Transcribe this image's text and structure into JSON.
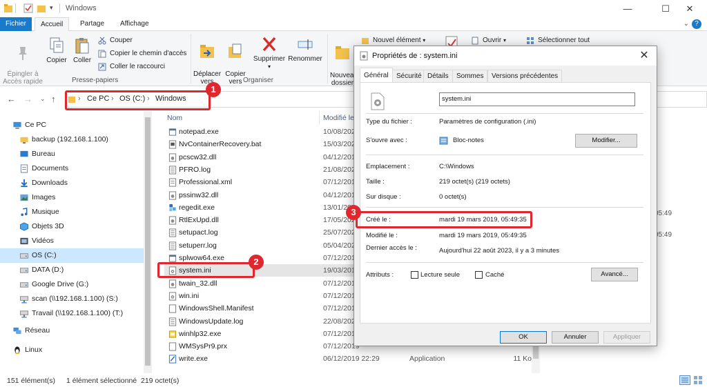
{
  "window": {
    "title": "Windows"
  },
  "ribbon_tabs": [
    "Fichier",
    "Accueil",
    "Partage",
    "Affichage"
  ],
  "ribbon": {
    "pin_label": "Épingler à\nAccès rapide",
    "copy_label": "Copier",
    "paste_label": "Coller",
    "cut_label": "Couper",
    "copy_path_label": "Copier le chemin d'accès",
    "paste_shortcut_label": "Coller le raccourci",
    "clipboard_group": "Presse-papiers",
    "move_label": "Déplacer\nvers",
    "copy_to_label": "Copier\nvers",
    "delete_label": "Supprimer",
    "rename_label": "Renommer",
    "organize_group": "Organiser",
    "new_folder_label": "Nouveau\ndossier",
    "new_item_label": "Nouvel élément",
    "open_label": "Ouvrir",
    "select_all_label": "Sélectionner tout"
  },
  "address": {
    "crumbs": [
      "Ce PC",
      "OS (C:)",
      "Windows"
    ]
  },
  "nav": [
    {
      "label": "Ce PC",
      "icon": "pc-icon",
      "indent": 0
    },
    {
      "label": "backup (192.168.1.100)",
      "icon": "network-folder-icon",
      "indent": 1
    },
    {
      "label": "Bureau",
      "icon": "desktop-icon",
      "indent": 1
    },
    {
      "label": "Documents",
      "icon": "documents-icon",
      "indent": 1
    },
    {
      "label": "Downloads",
      "icon": "downloads-icon",
      "indent": 1
    },
    {
      "label": "Images",
      "icon": "images-icon",
      "indent": 1
    },
    {
      "label": "Musique",
      "icon": "music-icon",
      "indent": 1
    },
    {
      "label": "Objets 3D",
      "icon": "3d-objects-icon",
      "indent": 1
    },
    {
      "label": "Vidéos",
      "icon": "videos-icon",
      "indent": 1
    },
    {
      "label": "OS (C:)",
      "icon": "drive-icon",
      "indent": 1,
      "selected": true
    },
    {
      "label": "DATA (D:)",
      "icon": "drive-icon",
      "indent": 1
    },
    {
      "label": "Google Drive (G:)",
      "icon": "drive-icon",
      "indent": 1
    },
    {
      "label": "scan (\\\\192.168.1.100) (S:)",
      "icon": "network-drive-icon",
      "indent": 1
    },
    {
      "label": "Travail (\\\\192.168.1.100) (T:)",
      "icon": "network-drive-icon",
      "indent": 1
    },
    {
      "label": "Réseau",
      "icon": "network-icon",
      "indent": 0
    },
    {
      "label": "Linux",
      "icon": "linux-icon",
      "indent": 0
    }
  ],
  "file_list": {
    "columns": [
      "Nom",
      "Modifié le"
    ],
    "rows": [
      {
        "name": "notepad.exe",
        "date": "10/08/2022",
        "type": "",
        "size": "",
        "icon": "exe-icon"
      },
      {
        "name": "NvContainerRecovery.bat",
        "date": "15/03/2022",
        "type": "",
        "size": "",
        "icon": "bat-icon"
      },
      {
        "name": "pcscw32.dll",
        "date": "04/12/2019",
        "type": "",
        "size": "",
        "icon": "dll-icon"
      },
      {
        "name": "PFRO.log",
        "date": "21/08/2023",
        "type": "",
        "size": "",
        "icon": "log-icon"
      },
      {
        "name": "Professional.xml",
        "date": "07/12/2019",
        "type": "",
        "size": "",
        "icon": "xml-icon"
      },
      {
        "name": "pssinw32.dll",
        "date": "04/12/2019",
        "type": "",
        "size": "",
        "icon": "dll-icon"
      },
      {
        "name": "regedit.exe",
        "date": "13/01/2023",
        "type": "",
        "size": "",
        "icon": "regedit-icon"
      },
      {
        "name": "RtlExUpd.dll",
        "date": "17/05/2022",
        "type": "",
        "size": "",
        "icon": "dll-icon"
      },
      {
        "name": "setupact.log",
        "date": "25/07/2023",
        "type": "",
        "size": "",
        "icon": "log-icon"
      },
      {
        "name": "setuperr.log",
        "date": "05/04/2023",
        "type": "",
        "size": "",
        "icon": "log-icon"
      },
      {
        "name": "splwow64.exe",
        "date": "07/12/2019",
        "type": "",
        "size": "",
        "icon": "exe-icon"
      },
      {
        "name": "system.ini",
        "date": "19/03/2019",
        "type": "",
        "size": "",
        "icon": "ini-icon",
        "selected": true
      },
      {
        "name": "twain_32.dll",
        "date": "07/12/2019",
        "type": "",
        "size": "",
        "icon": "dll-icon"
      },
      {
        "name": "win.ini",
        "date": "07/12/2019",
        "type": "",
        "size": "",
        "icon": "ini-icon"
      },
      {
        "name": "WindowsShell.Manifest",
        "date": "07/12/2019",
        "type": "",
        "size": "",
        "icon": "manifest-icon"
      },
      {
        "name": "WindowsUpdate.log",
        "date": "22/08/2023",
        "type": "",
        "size": "",
        "icon": "log-icon"
      },
      {
        "name": "winhlp32.exe",
        "date": "07/12/2019",
        "type": "",
        "size": "",
        "icon": "help-exe-icon"
      },
      {
        "name": "WMSysPr9.prx",
        "date": "07/12/2019",
        "type": "",
        "size": "",
        "icon": "file-icon"
      },
      {
        "name": "write.exe",
        "date": "06/12/2019 22:29",
        "type": "Application",
        "size": "11 Ko",
        "icon": "write-icon"
      }
    ],
    "bg_times": [
      "05:49",
      "05:49"
    ]
  },
  "status": {
    "count": "151 élément(s)",
    "selection": "1 élément sélectionné  219 octet(s)"
  },
  "dialog": {
    "title": "Propriétés de : system.ini",
    "tabs": [
      "Général",
      "Sécurité",
      "Détails",
      "Sommes",
      "Versions précédentes"
    ],
    "filename": "system.ini",
    "file_type_label": "Type du fichier :",
    "file_type_value": "Paramètres de configuration (.ini)",
    "opens_with_label": "S'ouvre avec :",
    "opens_with_value": "Bloc-notes",
    "modify_button": "Modifier...",
    "location_label": "Emplacement :",
    "location_value": "C:\\Windows",
    "size_label": "Taille :",
    "size_value": "219 octet(s) (219 octets)",
    "disk_size_label": "Sur disque :",
    "disk_size_value": "0 octet(s)",
    "created_label": "Créé le :",
    "created_value": "mardi 19 mars 2019, 05:49:35",
    "modified_label": "Modifié le :",
    "modified_value": "mardi 19 mars 2019, 05:49:35",
    "accessed_label": "Dernier accès le :",
    "accessed_value": "Aujourd'hui 22 août 2023, il y a 3 minutes",
    "attributes_label": "Attributs :",
    "readonly_label": "Lecture seule",
    "hidden_label": "Caché",
    "advanced_button": "Avancé...",
    "ok_button": "OK",
    "cancel_button": "Annuler",
    "apply_button": "Appliquer"
  },
  "annotations": [
    "1",
    "2",
    "3"
  ],
  "colors": {
    "accent": "#1979ca",
    "highlight": "#e0262f",
    "selection": "#cce8ff"
  }
}
